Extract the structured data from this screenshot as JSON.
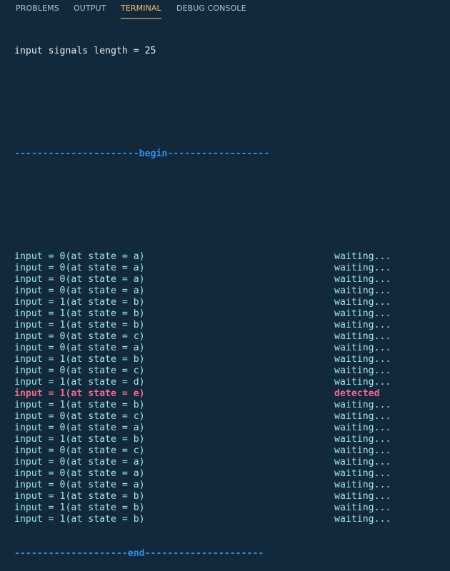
{
  "tabs": [
    {
      "label": "PROBLEMS"
    },
    {
      "label": "OUTPUT"
    },
    {
      "label": "TERMINAL"
    },
    {
      "label": "DEBUG CONSOLE"
    }
  ],
  "terminal": {
    "header": "input signals length = 25",
    "begin_line": "----------------------begin------------------",
    "end_line": "--------------------end---------------------",
    "rows": [
      {
        "text": "input = 0(at state = a)",
        "status": "waiting...",
        "detected": false
      },
      {
        "text": "input = 0(at state = a)",
        "status": "waiting...",
        "detected": false
      },
      {
        "text": "input = 0(at state = a)",
        "status": "waiting...",
        "detected": false
      },
      {
        "text": "input = 0(at state = a)",
        "status": "waiting...",
        "detected": false
      },
      {
        "text": "input = 1(at state = b)",
        "status": "waiting...",
        "detected": false
      },
      {
        "text": "input = 1(at state = b)",
        "status": "waiting...",
        "detected": false
      },
      {
        "text": "input = 1(at state = b)",
        "status": "waiting...",
        "detected": false
      },
      {
        "text": "input = 0(at state = c)",
        "status": "waiting...",
        "detected": false
      },
      {
        "text": "input = 0(at state = a)",
        "status": "waiting...",
        "detected": false
      },
      {
        "text": "input = 1(at state = b)",
        "status": "waiting...",
        "detected": false
      },
      {
        "text": "input = 0(at state = c)",
        "status": "waiting...",
        "detected": false
      },
      {
        "text": "input = 1(at state = d)",
        "status": "waiting...",
        "detected": false
      },
      {
        "text": "input = 1(at state = e)",
        "status": "detected",
        "detected": true
      },
      {
        "text": "input = 1(at state = b)",
        "status": "waiting...",
        "detected": false
      },
      {
        "text": "input = 0(at state = c)",
        "status": "waiting...",
        "detected": false
      },
      {
        "text": "input = 0(at state = a)",
        "status": "waiting...",
        "detected": false
      },
      {
        "text": "input = 1(at state = b)",
        "status": "waiting...",
        "detected": false
      },
      {
        "text": "input = 0(at state = c)",
        "status": "waiting...",
        "detected": false
      },
      {
        "text": "input = 0(at state = a)",
        "status": "waiting...",
        "detected": false
      },
      {
        "text": "input = 0(at state = a)",
        "status": "waiting...",
        "detected": false
      },
      {
        "text": "input = 0(at state = a)",
        "status": "waiting...",
        "detected": false
      },
      {
        "text": "input = 1(at state = b)",
        "status": "waiting...",
        "detected": false
      },
      {
        "text": "input = 1(at state = b)",
        "status": "waiting...",
        "detected": false
      },
      {
        "text": "input = 1(at state = b)",
        "status": "waiting...",
        "detected": false
      }
    ]
  },
  "colors": {
    "background": "#11293b",
    "active_tab": "#f5c26b",
    "separator": "#2b8fe8",
    "waiting_text": "#9ee8ef",
    "detected_text": "#f06a8c"
  }
}
